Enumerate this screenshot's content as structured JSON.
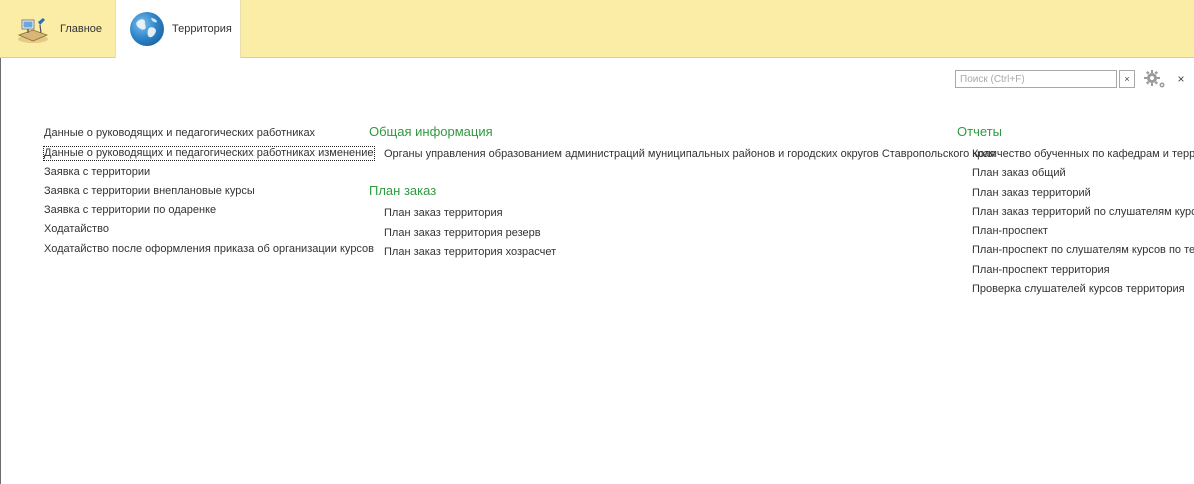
{
  "sections": {
    "main": {
      "label": "Главное",
      "icon": "home-desk-icon"
    },
    "territory": {
      "label": "Территория",
      "icon": "globe-icon"
    }
  },
  "search": {
    "placeholder": "Поиск (Ctrl+F)",
    "value": ""
  },
  "toolbar": {
    "clear_label": "×",
    "close_label": "×"
  },
  "column1": {
    "items": [
      "Данные о руководящих и педагогических работниках",
      "Данные о руководящих и педагогических работниках изменение",
      "Заявка с территории",
      "Заявка с территории внеплановые курсы",
      "Заявка с территории по одаренке",
      "Ходатайство",
      "Ходатайство после оформления приказа об организации курсов"
    ]
  },
  "column2": {
    "general": {
      "title": "Общая информация",
      "items": [
        "Органы управления образованием администраций муниципальных районов и городских округов Ставропольского края"
      ]
    },
    "plan": {
      "title": "План заказ",
      "items": [
        "План заказ территория",
        "План заказ территория резерв",
        "План заказ территория хозрасчет"
      ]
    }
  },
  "column3": {
    "title": "Отчеты",
    "items": [
      "Количество обученных по кафедрам и территориям",
      "План заказ общий",
      "План заказ территорий",
      "План заказ территорий по слушателям курсов",
      "План-проспект",
      "План-проспект по слушателям курсов по территориям",
      "План-проспект территория",
      "Проверка слушателей курсов территория"
    ]
  },
  "colors": {
    "section_bar": "#fbeca6",
    "group_title": "#2f9a3f",
    "link_text": "#333333"
  }
}
